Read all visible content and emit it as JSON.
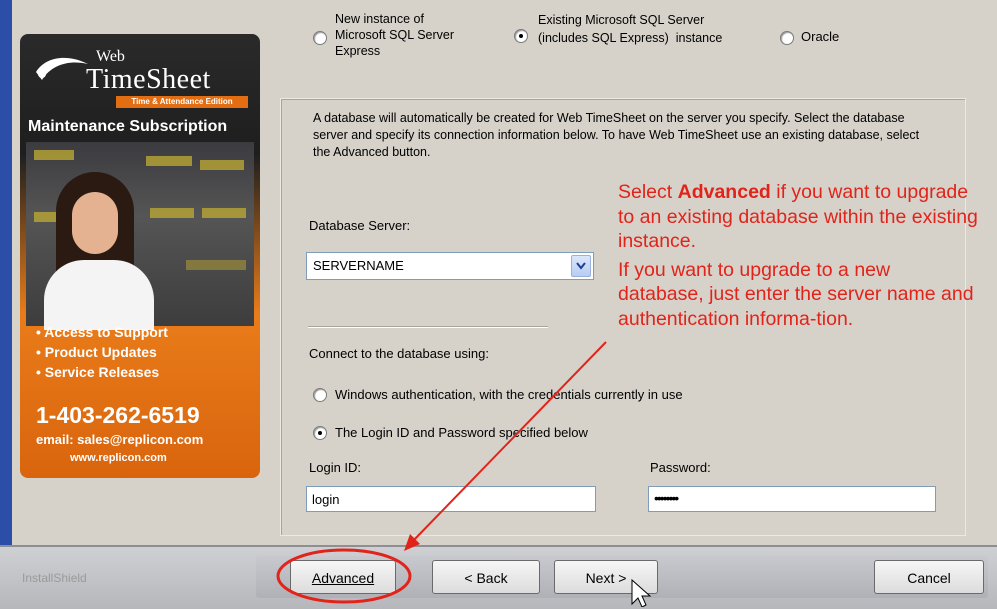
{
  "instance_options": {
    "new_instance": "New instance of\nMicrosoft SQL Server\nExpress",
    "existing_instance": "Existing Microsoft SQL Server\n(includes SQL Express)  instance",
    "oracle": "Oracle",
    "selected": "existing_instance"
  },
  "banner": {
    "web": "Web",
    "timesheet": "TimeSheet",
    "edition": "Time & Attendance Edition",
    "title": "Maintenance Subscription",
    "bullets": [
      "• Access to Support",
      "• Product Updates",
      "• Service Releases"
    ],
    "phone": "1-403-262-6519",
    "email": "email: sales@replicon.com",
    "website": "www.replicon.com"
  },
  "description": "A database will automatically be created for Web TimeSheet on the server you specify. Select the database server and specify its connection information below.  To have Web TimeSheet use an existing database, select the Advanced button.",
  "database_server": {
    "label": "Database Server:",
    "value": "SERVERNAME"
  },
  "connect": {
    "label": "Connect to the database using:",
    "windows_auth": "Windows authentication, with the credentials currently in use",
    "login_auth": "The Login ID and Password specified below",
    "selected": "login_auth"
  },
  "login": {
    "label": "Login ID:",
    "value": "login"
  },
  "password": {
    "label": "Password:",
    "value": "••••••••"
  },
  "annotation": {
    "line1_prefix": "Select ",
    "line1_bold": "Advanced",
    "line1_suffix": " if you want to upgrade to an existing database within the existing instance.",
    "line2": "If you want to upgrade to a new database, just enter the server name and authentication informa-tion."
  },
  "footer": {
    "installshield": "InstallShield",
    "advanced": "Advanced",
    "back": "< Back",
    "next": "Next >",
    "cancel": "Cancel"
  },
  "colors": {
    "annotation": "#e2231a",
    "banner_orange": "#e97c1a"
  }
}
